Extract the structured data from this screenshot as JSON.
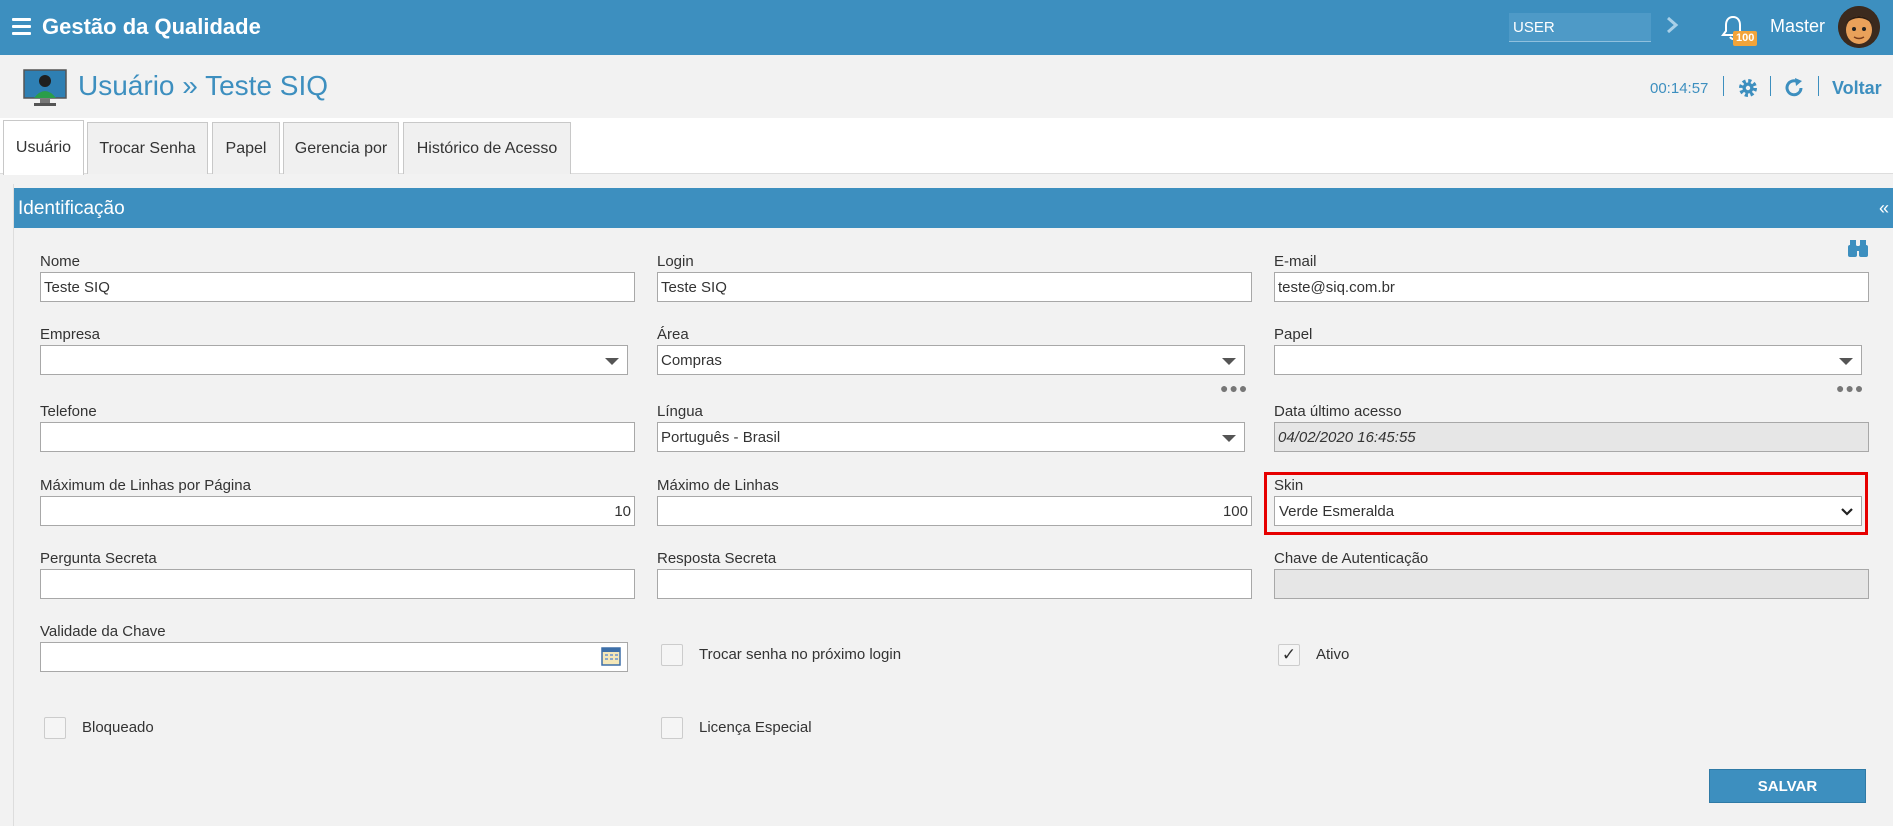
{
  "app": {
    "title": "Gestão da Qualidade"
  },
  "topbar": {
    "search_placeholder": "USER",
    "notification_count": "100",
    "user_name": "Master"
  },
  "header": {
    "title": "Usuário » Teste SIQ",
    "timer": "00:14:57",
    "back_label": "Voltar"
  },
  "tabs": [
    {
      "label": "Usuário",
      "active": true
    },
    {
      "label": "Trocar Senha"
    },
    {
      "label": "Papel"
    },
    {
      "label": "Gerencia por"
    },
    {
      "label": "Histórico de Acesso"
    }
  ],
  "panel": {
    "title": "Identificação",
    "collapse": "«"
  },
  "form": {
    "nome": {
      "label": "Nome",
      "value": "Teste SIQ"
    },
    "login": {
      "label": "Login",
      "value": "Teste SIQ"
    },
    "email": {
      "label": "E-mail",
      "value": "teste@siq.com.br"
    },
    "empresa": {
      "label": "Empresa",
      "value": ""
    },
    "area": {
      "label": "Área",
      "value": "Compras"
    },
    "papel": {
      "label": "Papel",
      "value": ""
    },
    "telefone": {
      "label": "Telefone",
      "value": ""
    },
    "lingua": {
      "label": "Língua",
      "value": "Português - Brasil"
    },
    "data_ultimo_acesso": {
      "label": "Data último acesso",
      "value": "04/02/2020 16:45:55"
    },
    "max_linhas_pagina": {
      "label": "Máximum de Linhas por Página",
      "value": "10"
    },
    "max_linhas": {
      "label": "Máximo de Linhas",
      "value": "100"
    },
    "skin": {
      "label": "Skin",
      "value": "Verde Esmeralda"
    },
    "pergunta_secreta": {
      "label": "Pergunta Secreta",
      "value": ""
    },
    "resposta_secreta": {
      "label": "Resposta Secreta",
      "value": ""
    },
    "chave_autenticacao": {
      "label": "Chave de Autenticação",
      "value": ""
    },
    "validade_chave": {
      "label": "Validade da Chave",
      "value": ""
    },
    "trocar_senha": {
      "label": "Trocar senha no próximo login",
      "checked": false
    },
    "ativo": {
      "label": "Ativo",
      "checked": true,
      "mark": "✓"
    },
    "bloqueado": {
      "label": "Bloqueado",
      "checked": false
    },
    "licenca_especial": {
      "label": "Licença Especial",
      "checked": false
    }
  },
  "actions": {
    "save_label": "SALVAR"
  },
  "colors": {
    "primary": "#3d8fbf",
    "badge": "#f2a43a",
    "highlight": "#e60000"
  }
}
